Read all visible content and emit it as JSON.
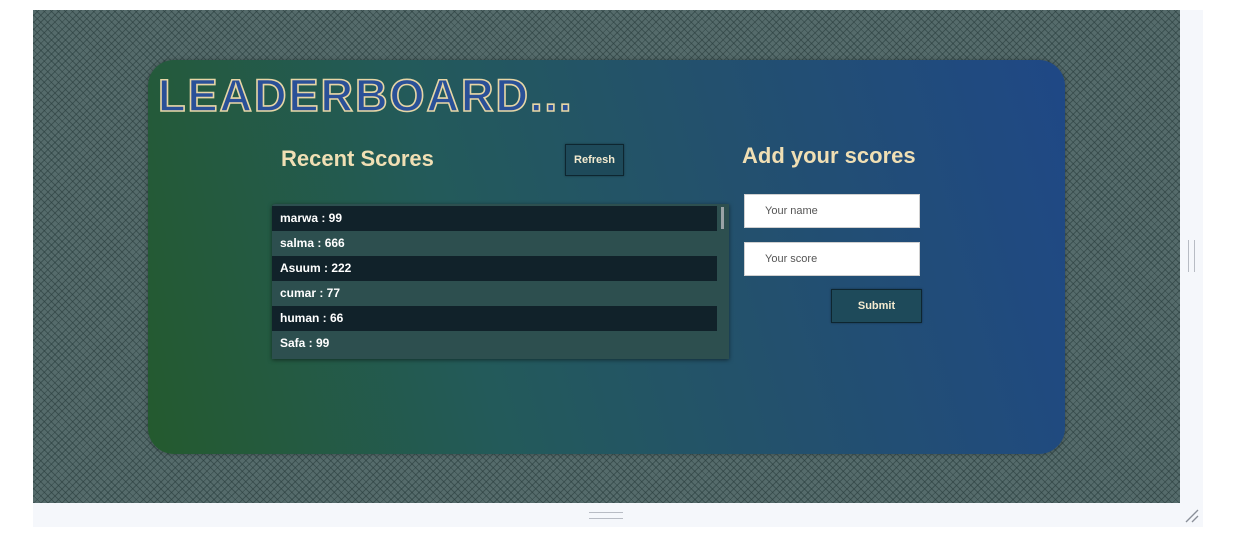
{
  "header": {
    "title": "LEADERBOARD..."
  },
  "recent": {
    "title": "Recent Scores",
    "refresh_label": "Refresh",
    "scores": [
      "marwa : 99",
      "salma : 666",
      "Asuum : 222",
      "cumar : 77",
      "human : 66",
      "Safa : 99"
    ]
  },
  "add": {
    "title": "Add your scores",
    "name_placeholder": "Your name",
    "score_placeholder": "Your score",
    "submit_label": "Submit"
  },
  "colors": {
    "accent_text": "#f0dfb4",
    "button_bg": "#1e4a5a",
    "title_fill": "#2a5098"
  }
}
